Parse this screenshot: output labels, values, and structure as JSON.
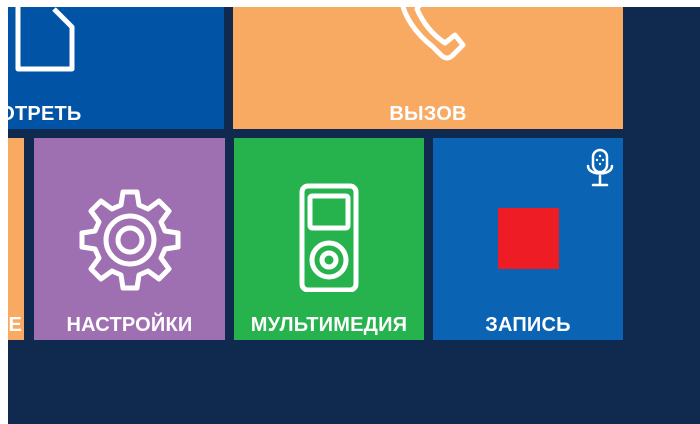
{
  "tiles": {
    "view": {
      "label": "СМОТРЕТЬ",
      "color": "#0153a5",
      "icon": "home-icon"
    },
    "call": {
      "label": "ВЫЗОВ",
      "color": "#f8a962",
      "icon": "phone-icon"
    },
    "left_partial": {
      "label": "Е",
      "color": "#f8a962"
    },
    "settings": {
      "label": "НАСТРОЙКИ",
      "color": "#9f70b1",
      "icon": "gear-icon"
    },
    "multimedia": {
      "label": "МУЛЬТИМЕДИЯ",
      "color": "#26b24c",
      "icon": "media-player-icon"
    },
    "record": {
      "label": "ЗАПИСЬ",
      "color": "#0a63b3",
      "icon": "record-stop-icon",
      "mic_icon": "microphone-icon",
      "stop_color": "#ee1c25"
    }
  },
  "screen": {
    "background": "#10294f"
  }
}
